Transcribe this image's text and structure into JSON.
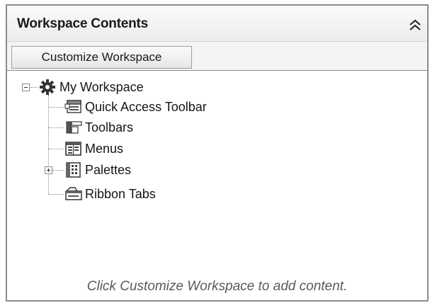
{
  "panel": {
    "title": "Workspace Contents",
    "customize_button_label": "Customize Workspace",
    "hint": "Click Customize Workspace to add content."
  },
  "tree": {
    "root": {
      "label": "My Workspace",
      "icon": "gear-icon",
      "expanded": true
    },
    "children": [
      {
        "label": "Quick Access Toolbar",
        "icon": "quick-access-toolbar-icon",
        "expandable": false
      },
      {
        "label": "Toolbars",
        "icon": "toolbars-icon",
        "expandable": false
      },
      {
        "label": "Menus",
        "icon": "menus-icon",
        "expandable": false
      },
      {
        "label": "Palettes",
        "icon": "palettes-icon",
        "expandable": true,
        "expanded": false
      },
      {
        "label": "Ribbon Tabs",
        "icon": "ribbon-tabs-icon",
        "expandable": false
      }
    ]
  }
}
